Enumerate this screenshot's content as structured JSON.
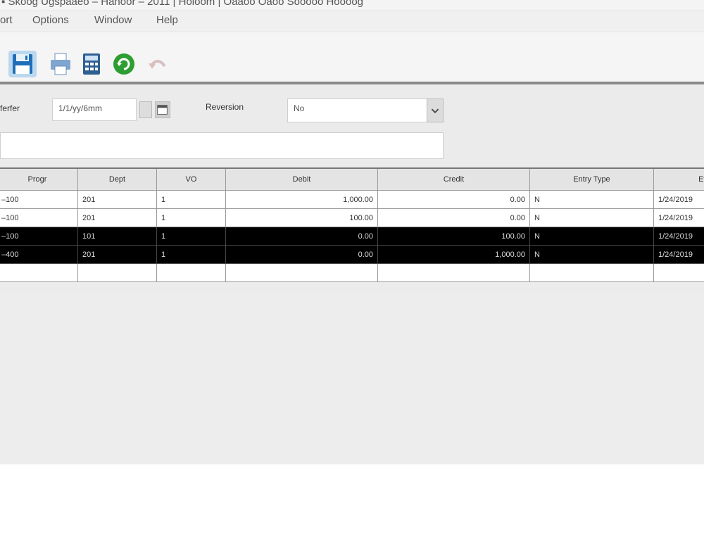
{
  "window": {
    "title": "▪ Skoog Ugspaaeo – Hanoor – 2011 | Holoom | Oaaoo Oaoo Sooooo Hoooog"
  },
  "menubar": {
    "items": [
      "ort",
      "Options",
      "Window",
      "Help"
    ]
  },
  "toolbar": {
    "buttons": [
      {
        "name": "save-icon"
      },
      {
        "name": "print-icon"
      },
      {
        "name": "calculator-icon"
      },
      {
        "name": "refresh-icon"
      },
      {
        "name": "undo-icon"
      }
    ]
  },
  "form": {
    "date_label": "ferfer",
    "date_value": "1/1/yy/6mm",
    "reversal_label": "Reversion",
    "reversal_value": "No",
    "description_value": ""
  },
  "grid": {
    "columns": [
      "Progr",
      "Dept",
      "VO",
      "Debit",
      "Credit",
      "Entry Type",
      "Effec"
    ],
    "rows": [
      {
        "progr": "–100",
        "dept": "201",
        "vo": "1",
        "debit": "1,000.00",
        "credit": "0.00",
        "entry_type": "N",
        "effective": "1/24/2019"
      },
      {
        "progr": "–100",
        "dept": "201",
        "vo": "1",
        "debit": "100.00",
        "credit": "0.00",
        "entry_type": "N",
        "effective": "1/24/2019"
      },
      {
        "progr": "–100",
        "dept": "101",
        "vo": "1",
        "debit": "0.00",
        "credit": "100.00",
        "entry_type": "N",
        "effective": "1/24/2019",
        "selected": true
      },
      {
        "progr": "–400",
        "dept": "201",
        "vo": "1",
        "debit": "0.00",
        "credit": "1,000.00",
        "entry_type": "N",
        "effective": "1/24/2019",
        "selected": true
      },
      {
        "progr": "",
        "dept": "",
        "vo": "",
        "debit": "",
        "credit": "",
        "entry_type": "",
        "effective": ""
      }
    ]
  },
  "colors": {
    "selected_row": "#000000",
    "panel": "#ebebeb",
    "accent_green": "#2e9e32"
  }
}
